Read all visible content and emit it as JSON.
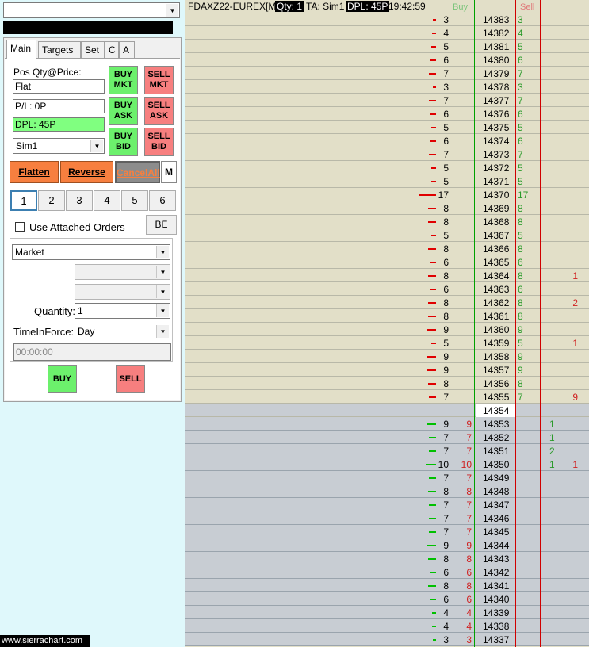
{
  "left": {
    "symbol_combo": "",
    "tabs": [
      "Main",
      "Targets",
      "Set",
      "C",
      "A"
    ],
    "pos_label": "Pos Qty@Price:",
    "pos_value": "Flat",
    "pl_value": "P/L: 0P",
    "dpl_value": "DPL: 45P",
    "account": "Sim1",
    "buttons": {
      "buy_mkt": "BUY\nMKT",
      "sell_mkt": "SELL\nMKT",
      "buy_ask": "BUY\nASK",
      "sell_ask": "SELL\nASK",
      "buy_bid": "BUY\nBID",
      "sell_bid": "SELL\nBID"
    },
    "flatten": "Flatten",
    "reverse": "Reverse",
    "cancel_all": "CancelAll",
    "m": "M",
    "qty_presets": [
      "1",
      "2",
      "3",
      "4",
      "5",
      "6"
    ],
    "use_attached": "Use Attached Orders",
    "be": "BE",
    "order_type": "Market",
    "quantity_label": "Quantity:",
    "quantity": "1",
    "tif_label": "TimeInForce:",
    "tif": "Day",
    "time_field": "00:00:00",
    "buy": "BUY",
    "sell": "SELL",
    "watermark": "www.sierrachart.com"
  },
  "dom": {
    "symbol": "FDAXZ22-EUREX[M]",
    "qty": "Qty: 1",
    "ta": "TA: Sim1",
    "dpl": "DPL: 45P",
    "time": "19:42:59",
    "buy_header": "Buy",
    "sell_header": "Sell",
    "colors": {
      "ask_bar": "#e00000",
      "bid_bar": "#00c000",
      "ask_text": "#2a9a2a",
      "bid_text": "#d02020"
    },
    "rows": [
      {
        "price": "14383",
        "ask": "3",
        "sell": ""
      },
      {
        "price": "14382",
        "ask": "4",
        "sell": ""
      },
      {
        "price": "14381",
        "ask": "5",
        "sell": ""
      },
      {
        "price": "14380",
        "ask": "6",
        "sell": ""
      },
      {
        "price": "14379",
        "ask": "7",
        "sell": ""
      },
      {
        "price": "14378",
        "ask": "3",
        "sell": ""
      },
      {
        "price": "14377",
        "ask": "7",
        "sell": ""
      },
      {
        "price": "14376",
        "ask": "6",
        "sell": ""
      },
      {
        "price": "14375",
        "ask": "5",
        "sell": ""
      },
      {
        "price": "14374",
        "ask": "6",
        "sell": ""
      },
      {
        "price": "14373",
        "ask": "7",
        "sell": ""
      },
      {
        "price": "14372",
        "ask": "5",
        "sell": ""
      },
      {
        "price": "14371",
        "ask": "5",
        "sell": ""
      },
      {
        "price": "14370",
        "ask": "17",
        "sell": ""
      },
      {
        "price": "14369",
        "ask": "8",
        "sell": ""
      },
      {
        "price": "14368",
        "ask": "8",
        "sell": ""
      },
      {
        "price": "14367",
        "ask": "5",
        "sell": ""
      },
      {
        "price": "14366",
        "ask": "8",
        "sell": ""
      },
      {
        "price": "14365",
        "ask": "6",
        "sell": ""
      },
      {
        "price": "14364",
        "ask": "8",
        "sell": "1"
      },
      {
        "price": "14363",
        "ask": "6",
        "sell": ""
      },
      {
        "price": "14362",
        "ask": "8",
        "sell": "2"
      },
      {
        "price": "14361",
        "ask": "8",
        "sell": ""
      },
      {
        "price": "14360",
        "ask": "9",
        "sell": ""
      },
      {
        "price": "14359",
        "ask": "5",
        "sell": "1"
      },
      {
        "price": "14358",
        "ask": "9",
        "sell": ""
      },
      {
        "price": "14357",
        "ask": "9",
        "sell": ""
      },
      {
        "price": "14356",
        "ask": "8",
        "sell": ""
      },
      {
        "price": "14355",
        "ask": "7",
        "sell": "9"
      },
      {
        "price": "14354",
        "current": true
      },
      {
        "price": "14353",
        "bid": "9",
        "bid_vol": "1",
        "sell": ""
      },
      {
        "price": "14352",
        "bid": "7",
        "bid_vol": "1",
        "sell": ""
      },
      {
        "price": "14351",
        "bid": "7",
        "bid_vol": "2",
        "sell": ""
      },
      {
        "price": "14350",
        "bid": "10",
        "bid_vol": "1",
        "sell": "1"
      },
      {
        "price": "14349",
        "bid": "7",
        "bid_vol": "",
        "sell": ""
      },
      {
        "price": "14348",
        "bid": "8",
        "bid_vol": "",
        "sell": ""
      },
      {
        "price": "14347",
        "bid": "7",
        "bid_vol": "",
        "sell": ""
      },
      {
        "price": "14346",
        "bid": "7",
        "bid_vol": "",
        "sell": ""
      },
      {
        "price": "14345",
        "bid": "7",
        "bid_vol": "",
        "sell": ""
      },
      {
        "price": "14344",
        "bid": "9",
        "bid_vol": "",
        "sell": ""
      },
      {
        "price": "14343",
        "bid": "8",
        "bid_vol": "",
        "sell": ""
      },
      {
        "price": "14342",
        "bid": "6",
        "bid_vol": "",
        "sell": ""
      },
      {
        "price": "14341",
        "bid": "8",
        "bid_vol": "",
        "sell": ""
      },
      {
        "price": "14340",
        "bid": "6",
        "bid_vol": "",
        "sell": ""
      },
      {
        "price": "14339",
        "bid": "4",
        "bid_vol": "",
        "sell": ""
      },
      {
        "price": "14338",
        "bid": "4",
        "bid_vol": "",
        "sell": ""
      },
      {
        "price": "14337",
        "bid": "3",
        "bid_vol": "",
        "sell": ""
      }
    ]
  }
}
